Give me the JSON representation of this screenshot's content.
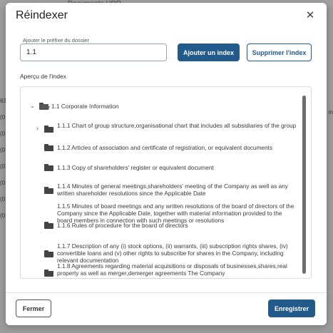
{
  "background": {
    "title": "Documents HDR",
    "left_values": [
      "63",
      "(0",
      "(0",
      "(0",
      "(0",
      "(0",
      "(0",
      "(0"
    ],
    "right_value": "m"
  },
  "dialog": {
    "title": "Réindexer",
    "close_icon": "close-icon",
    "prefix": {
      "label": "Ajouter le préfixe du dossier",
      "value": "1.1"
    },
    "add_button": "Ajouter un index",
    "remove_button": "Supprimer l'index",
    "preview_label": "Aperçu de l'index",
    "tree": {
      "root": {
        "label": "1.1 Corporate Information",
        "expanded": true,
        "icon": "folder-open-icon"
      },
      "children": [
        {
          "label": "1.1.1 Chart of group structure,organisational chart that includes all subsidiaries of the group",
          "has_children": true
        },
        {
          "label": "1.1.2 Articles of association and certificate of registration, or equivalent documents",
          "has_children": false
        },
        {
          "label": "1.1.3 Copy of shareholders' register or equivalent document",
          "has_children": false
        },
        {
          "label": "1.1.4 Minutes of general meetings,shareholders' meeting of the Company as well as any written shareholder resolutions since the Applicable Date",
          "has_children": false
        },
        {
          "label": "1.1.5 Minutes of board meetings and any written resolutions of the board of directors of the Company since the Applicable Date, together with material information provided to the board members in connection with such meetings or resolutions",
          "has_children": false
        },
        {
          "label": "1.1.6 Rules of procedure for the board of directors",
          "has_children": false
        },
        {
          "label": "1.1.7 Description of any (i) stock options, (ii) warrants, (iii) subscription rights shares, (iv) convertible loans and (v) other rights to subscribe for shares in the Company, including relevant documentation",
          "has_children": false
        },
        {
          "label": "1.1.8 Agreements regarding material acquisitions or disposals of businesses,shares,real property as well as merger,demerger agreements The Company",
          "has_children": false
        }
      ]
    },
    "footer": {
      "close_button": "Fermer",
      "save_button": "Enregistrer"
    },
    "colors": {
      "primary": "#225a8c",
      "overlay": "#8d8d8d"
    }
  }
}
